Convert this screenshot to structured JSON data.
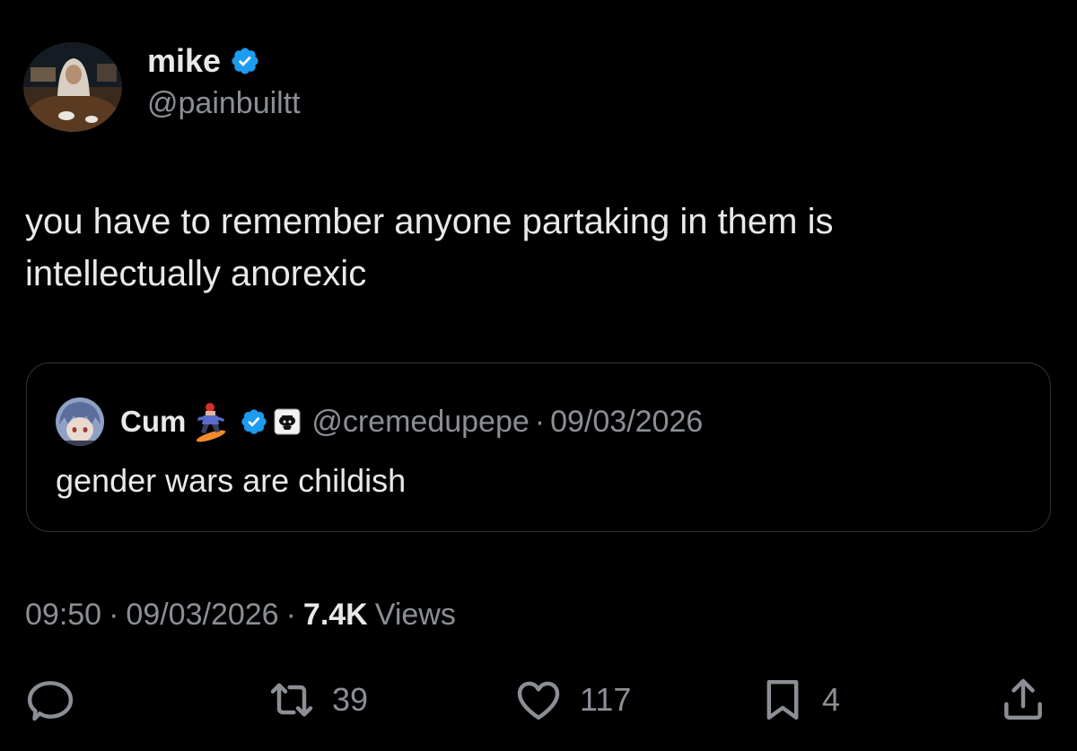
{
  "tweet": {
    "author": {
      "display_name": "mike",
      "handle": "@painbuiltt",
      "verified_icon": "verified-badge-icon"
    },
    "text_lines": [
      "you have to remember anyone partaking in them is",
      "intellectually anorexic"
    ],
    "quote": {
      "display_name": "Cum",
      "emoji": "snowboarder-emoji",
      "verified_icon": "verified-badge-icon",
      "affiliate_badge": "affiliate-badge-icon",
      "handle": "@cremedupepe",
      "separator": "·",
      "date": "09/03/2026",
      "text": "gender wars are childish"
    },
    "meta": {
      "time": "09:50",
      "separator": "·",
      "date": "09/03/2026",
      "views_count": "7.4K",
      "views_label": "Views"
    },
    "actions": {
      "reply": {
        "icon": "reply-icon",
        "count": ""
      },
      "retweet": {
        "icon": "retweet-icon",
        "count": "39"
      },
      "like": {
        "icon": "heart-icon",
        "count": "117"
      },
      "bookmark": {
        "icon": "bookmark-icon",
        "count": "4"
      },
      "share": {
        "icon": "share-icon",
        "count": ""
      }
    }
  },
  "colors": {
    "background": "#000000",
    "primary_text": "#e7e9ea",
    "secondary_text": "#8b8f95",
    "verified_blue": "#1d9bf0",
    "border": "#2f3336"
  }
}
